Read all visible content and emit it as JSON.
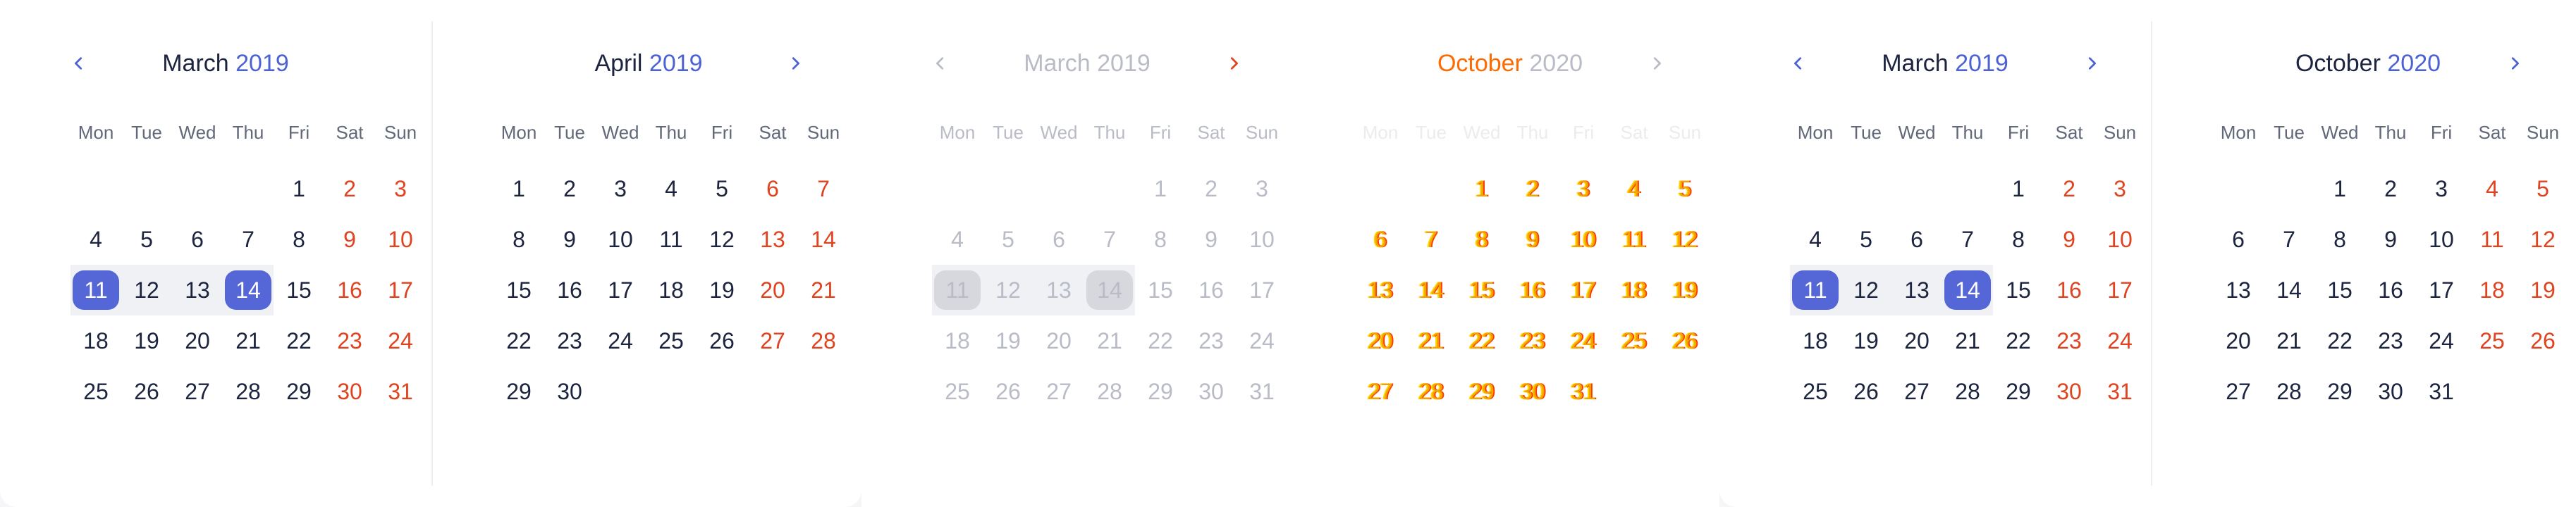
{
  "weekdays": [
    "Mon",
    "Tue",
    "Wed",
    "Thu",
    "Fri",
    "Sat",
    "Sun"
  ],
  "months": {
    "march_2019": {
      "name": "March",
      "year": "2019"
    },
    "april_2019": {
      "name": "April",
      "year": "2019"
    },
    "october_2020": {
      "name": "October",
      "year": "2020"
    }
  },
  "colors": {
    "accent": "#4c62d3",
    "selection": "#5566d6",
    "weekend": "#e0431f",
    "text": "#1c2440",
    "range_bg": "#f0f1f5"
  },
  "selection": {
    "start": 11,
    "end": 14
  },
  "icons": {
    "prev": "chevron-left-icon",
    "next": "chevron-right-icon"
  }
}
